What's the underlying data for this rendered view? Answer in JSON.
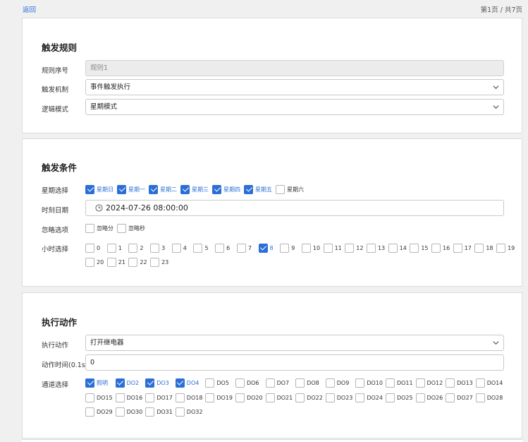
{
  "header": {
    "back": "返回",
    "page_info": "第1页 / 共7页"
  },
  "trigger_rule": {
    "title": "触发规则",
    "rule_no_label": "规则序号",
    "rule_no_value": "规则1",
    "mechanism_label": "触发机制",
    "mechanism_value": "事件触发执行",
    "logic_label": "逻辑模式",
    "logic_value": "星期模式"
  },
  "conditions": {
    "title": "触发条件",
    "week_label": "星期选择",
    "weekdays": [
      {
        "label": "星期日",
        "checked": true
      },
      {
        "label": "星期一",
        "checked": true
      },
      {
        "label": "星期二",
        "checked": true
      },
      {
        "label": "星期三",
        "checked": true
      },
      {
        "label": "星期四",
        "checked": true
      },
      {
        "label": "星期五",
        "checked": true
      },
      {
        "label": "星期六",
        "checked": false
      }
    ],
    "datetime_label": "时刻日期",
    "datetime_value": "2024-07-26 08:00:00",
    "ignore_label": "忽略选项",
    "ignore": [
      {
        "label": "忽略分",
        "checked": false
      },
      {
        "label": "忽略秒",
        "checked": false
      }
    ],
    "hour_label": "小时选择",
    "hours_row1": [
      {
        "label": "0",
        "checked": false
      },
      {
        "label": "1",
        "checked": false
      },
      {
        "label": "2",
        "checked": false
      },
      {
        "label": "3",
        "checked": false
      },
      {
        "label": "4",
        "checked": false
      },
      {
        "label": "5",
        "checked": false
      },
      {
        "label": "6",
        "checked": false
      },
      {
        "label": "7",
        "checked": false
      },
      {
        "label": "8",
        "checked": true
      },
      {
        "label": "9",
        "checked": false
      },
      {
        "label": "10",
        "checked": false
      },
      {
        "label": "11",
        "checked": false
      },
      {
        "label": "12",
        "checked": false
      },
      {
        "label": "13",
        "checked": false
      },
      {
        "label": "14",
        "checked": false
      },
      {
        "label": "15",
        "checked": false
      },
      {
        "label": "16",
        "checked": false
      },
      {
        "label": "17",
        "checked": false
      },
      {
        "label": "18",
        "checked": false
      },
      {
        "label": "19",
        "checked": false
      }
    ],
    "hours_row2": [
      {
        "label": "20",
        "checked": false
      },
      {
        "label": "21",
        "checked": false
      },
      {
        "label": "22",
        "checked": false
      },
      {
        "label": "23",
        "checked": false
      }
    ]
  },
  "actions": {
    "title": "执行动作",
    "action_label": "执行动作",
    "action_value": "打开继电器",
    "duration_label": "动作时间(0.1s)",
    "duration_value": "0",
    "channel_label": "通道选择",
    "channels_row1": [
      {
        "label": "照明",
        "checked": true
      },
      {
        "label": "DO2",
        "checked": true
      },
      {
        "label": "DO3",
        "checked": true
      },
      {
        "label": "DO4",
        "checked": true
      },
      {
        "label": "DO5",
        "checked": false
      },
      {
        "label": "DO6",
        "checked": false
      },
      {
        "label": "DO7",
        "checked": false
      },
      {
        "label": "DO8",
        "checked": false
      },
      {
        "label": "DO9",
        "checked": false
      },
      {
        "label": "DO10",
        "checked": false
      },
      {
        "label": "DO11",
        "checked": false
      },
      {
        "label": "DO12",
        "checked": false
      },
      {
        "label": "DO13",
        "checked": false
      },
      {
        "label": "DO14",
        "checked": false
      }
    ],
    "channels_row2": [
      {
        "label": "DO15",
        "checked": false
      },
      {
        "label": "DO16",
        "checked": false
      },
      {
        "label": "DO17",
        "checked": false
      },
      {
        "label": "DO18",
        "checked": false
      },
      {
        "label": "DO19",
        "checked": false
      },
      {
        "label": "DO20",
        "checked": false
      },
      {
        "label": "DO21",
        "checked": false
      },
      {
        "label": "DO22",
        "checked": false
      },
      {
        "label": "DO23",
        "checked": false
      },
      {
        "label": "DO24",
        "checked": false
      },
      {
        "label": "DO25",
        "checked": false
      },
      {
        "label": "DO26",
        "checked": false
      },
      {
        "label": "DO27",
        "checked": false
      },
      {
        "label": "DO28",
        "checked": false
      }
    ],
    "channels_row3": [
      {
        "label": "DO29",
        "checked": false
      },
      {
        "label": "DO30",
        "checked": false
      },
      {
        "label": "DO31",
        "checked": false
      },
      {
        "label": "DO32",
        "checked": false
      }
    ]
  }
}
